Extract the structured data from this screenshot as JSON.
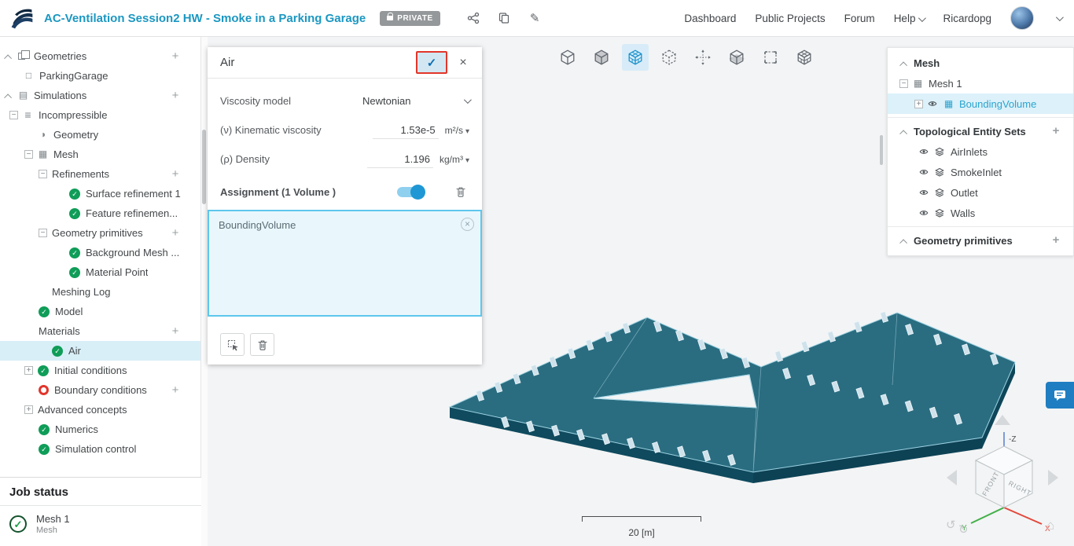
{
  "header": {
    "title": "AC-Ventilation Session2 HW - Smoke in a Parking Garage",
    "privacy_badge": "PRIVATE",
    "nav": {
      "dashboard": "Dashboard",
      "public_projects": "Public Projects",
      "forum": "Forum",
      "help": "Help",
      "user": "Ricardopg"
    }
  },
  "left_tree": {
    "items": [
      "Geometries",
      "ParkingGarage",
      "Simulations",
      "Incompressible",
      "Geometry",
      "Mesh",
      "Refinements",
      "Surface refinement 1",
      "Feature refinemen...",
      "Geometry primitives",
      "Background Mesh ...",
      "Material Point",
      "Meshing Log",
      "Model",
      "Materials",
      "Air",
      "Initial conditions",
      "Boundary conditions",
      "Advanced concepts",
      "Numerics",
      "Simulation control"
    ]
  },
  "job_status": {
    "title": "Job status",
    "name": "Mesh 1",
    "type": "Mesh"
  },
  "properties_panel": {
    "title": "Air",
    "viscosity_model": {
      "label": "Viscosity model",
      "value": "Newtonian"
    },
    "kinematic_viscosity": {
      "label": "(ν) Kinematic viscosity",
      "value": "1.53e-5",
      "unit": "m²/s"
    },
    "density": {
      "label": "(ρ) Density",
      "value": "1.196",
      "unit": "kg/m³"
    },
    "assignment": {
      "label": "Assignment (1 Volume )",
      "item": "BoundingVolume"
    }
  },
  "right_tree": {
    "mesh_title": "Mesh",
    "mesh_item": "Mesh 1",
    "mesh_child": "BoundingVolume",
    "topo_title": "Topological Entity Sets",
    "topo_items": [
      "AirInlets",
      "SmokeInlet",
      "Outlet",
      "Walls"
    ],
    "prim_title": "Geometry primitives"
  },
  "viewport": {
    "scale_label": "20 [m]",
    "gizmo": {
      "front": "FRONT",
      "right": "RIGHT",
      "x": "X",
      "y": "Y",
      "z": "-Z"
    },
    "toolbar_icons": [
      "fit-view-icon",
      "solid-view-icon",
      "mesh-view-icon",
      "wireframe-view-icon",
      "move-icon",
      "section-plane-icon",
      "box-select-icon",
      "mesh-quality-icon"
    ]
  },
  "colors": {
    "accent": "#1b97c1",
    "selected_bg": "#d8eff8",
    "check_green": "#0f9d58",
    "highlight_red": "#e2362a",
    "model_teal": "#1d6479",
    "toggle_blue": "#1f97d4"
  }
}
